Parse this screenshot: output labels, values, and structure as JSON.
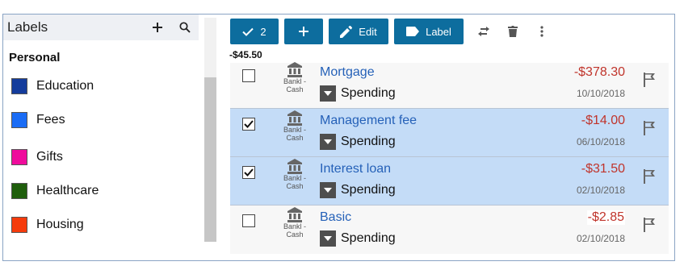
{
  "labels_panel": {
    "title": "Labels",
    "add_icon": "plus-icon",
    "search_icon": "search-icon",
    "group": "Personal",
    "items": [
      {
        "label": "Education",
        "color": "#143c9c"
      },
      {
        "label": "Fees",
        "color": "#1a6cf5"
      },
      {
        "label": "Gifts",
        "color": "#ef0c9c"
      },
      {
        "label": "Healthcare",
        "color": "#1f5e0c"
      },
      {
        "label": "Housing",
        "color": "#f53b0c"
      }
    ]
  },
  "toolbar": {
    "select_count": "2",
    "edit_label": "Edit",
    "label_label": "Label"
  },
  "selection_total": "-$45.50",
  "transactions": [
    {
      "payee": "Mortgage",
      "account": "Bankl - Cash",
      "category": "Spending",
      "amount": "-$378.30",
      "date": "10/10/2018",
      "checked": false
    },
    {
      "payee": "Management fee",
      "account": "Bankl - Cash",
      "category": "Spending",
      "amount": "-$14.00",
      "date": "06/10/2018",
      "checked": true
    },
    {
      "payee": "Interest loan",
      "account": "Bankl - Cash",
      "category": "Spending",
      "amount": "-$31.50",
      "date": "02/10/2018",
      "checked": true
    },
    {
      "payee": "Basic",
      "account": "Bankl - Cash",
      "category": "Spending",
      "amount": "-$2.85",
      "date": "02/10/2018",
      "checked": false
    }
  ],
  "colors": {
    "accent": "#0d6d9e",
    "selected_row": "#c4dcf7",
    "amount": "#c0342b",
    "link": "#2561b8"
  }
}
